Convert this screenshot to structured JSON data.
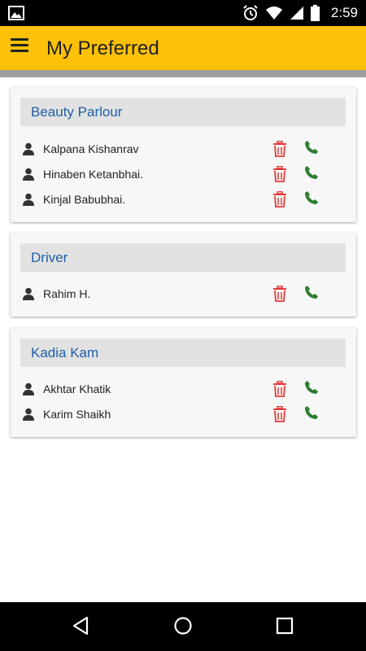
{
  "status_bar": {
    "time": "2:59",
    "icons": [
      "image-icon",
      "alarm-icon",
      "wifi-icon",
      "signal-icon",
      "battery-icon"
    ]
  },
  "app_bar": {
    "title": "My Preferred",
    "menu_icon": "hamburger-menu-icon",
    "background": "#ffc107"
  },
  "groups": [
    {
      "name": "Beauty Parlour",
      "contacts": [
        {
          "name": "Kalpana Kishanrav"
        },
        {
          "name": "Hinaben Ketanbhai."
        },
        {
          "name": "Kinjal Babubhai."
        }
      ]
    },
    {
      "name": "Driver",
      "contacts": [
        {
          "name": "Rahim H."
        }
      ]
    },
    {
      "name": "Kadia Kam",
      "contacts": [
        {
          "name": "Akhtar Khatik"
        },
        {
          "name": "Karim Shaikh"
        }
      ]
    }
  ],
  "colors": {
    "group_title": "#1e5fa6",
    "delete": "#e53935",
    "call": "#2e7d32"
  },
  "nav_bar": {
    "icons": [
      "back-icon",
      "home-icon",
      "recent-apps-icon"
    ]
  }
}
